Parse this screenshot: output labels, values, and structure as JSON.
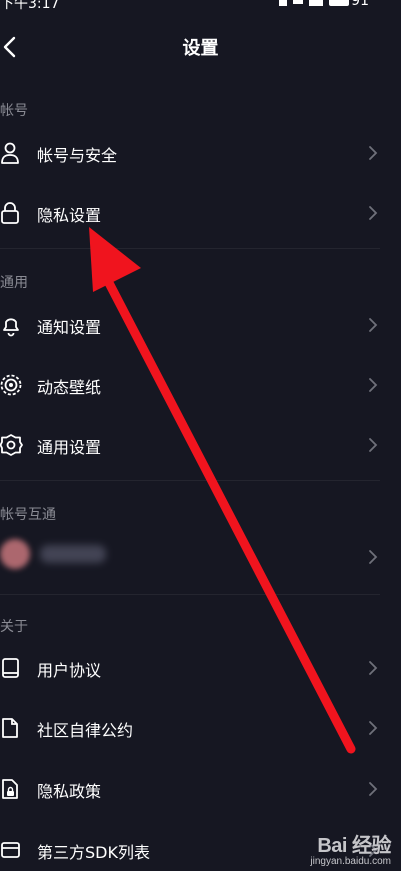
{
  "status_bar": {
    "time": "下午3:17",
    "battery": "91"
  },
  "header": {
    "title": "设置"
  },
  "sections": {
    "account": {
      "title": "帐号",
      "items": [
        {
          "label": "帐号与安全",
          "icon": "user-icon"
        },
        {
          "label": "隐私设置",
          "icon": "lock-icon"
        }
      ]
    },
    "general": {
      "title": "通用",
      "items": [
        {
          "label": "通知设置",
          "icon": "bell-icon"
        },
        {
          "label": "动态壁纸",
          "icon": "wallpaper-icon"
        },
        {
          "label": "通用设置",
          "icon": "gear-icon"
        }
      ]
    },
    "linked": {
      "title": "帐号互通"
    },
    "about": {
      "title": "关于",
      "items": [
        {
          "label": "用户协议",
          "icon": "book-icon"
        },
        {
          "label": "社区自律公约",
          "icon": "document-icon"
        },
        {
          "label": "隐私政策",
          "icon": "document-lock-icon"
        },
        {
          "label": "第三方SDK列表",
          "icon": "card-icon"
        }
      ]
    }
  },
  "watermark": {
    "logo": "Bai 经验",
    "url": "jingyan.baidu.com"
  },
  "colors": {
    "background": "#161722",
    "section_title": "#8a8b94",
    "chevron": "#6f707a",
    "annotation_arrow": "#f0141e"
  }
}
